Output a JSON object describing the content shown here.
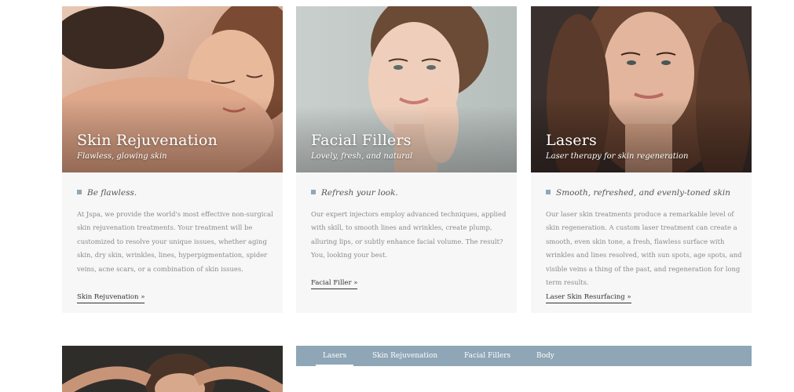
{
  "cards": [
    {
      "title": "Skin Rejuvenation",
      "subtitle": "Flawless, glowing skin",
      "tagline": "Be flawless.",
      "body": "At Jspa, we provide the world's most effective non-surgical skin rejuvenation treatments. Your treatment will be customized to resolve your unique issues, whether aging skin, dry skin, wrinkles, lines, hyperpigmentation, spider veins, acne scars, or a combination of skin issues.",
      "link": "Skin Rejuvenation »"
    },
    {
      "title": "Facial Fillers",
      "subtitle": "Lovely, fresh, and natural",
      "tagline": "Refresh your look.",
      "body": "Our expert injectors employ advanced techniques, applied with skill, to smooth lines and wrinkles, create plump, alluring lips, or subtly enhance facial volume. The result? You, looking your best.",
      "link": "Facial Filler »"
    },
    {
      "title": "Lasers",
      "subtitle": "Laser therapy for skin regeneration",
      "tagline": "Smooth, refreshed, and evenly-toned skin",
      "body": "Our laser skin treatments produce a remarkable level of skin regeneration. A custom laser treatment can create a smooth, even skin tone, a fresh, flawless surface with wrinkles and lines resolved, with sun spots, age spots, and visible veins a thing of the past, and regeneration for long term results.",
      "link": "Laser Skin Resurfacing »"
    }
  ],
  "tabs": {
    "items": [
      "Lasers",
      "Skin Rejuvenation",
      "Facial Fillers",
      "Body"
    ],
    "active": "Lasers"
  },
  "colors": {
    "accent": "#8ea6b6",
    "card_bg": "#f7f7f7"
  }
}
